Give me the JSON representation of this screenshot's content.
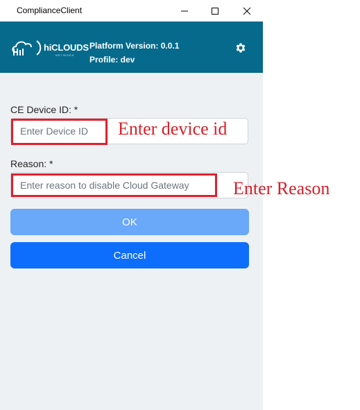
{
  "window": {
    "title": "ComplianceClient",
    "controls": {
      "minimize_icon": "minimize-icon",
      "maximize_icon": "maximize-icon",
      "close_icon": "close-icon"
    }
  },
  "header": {
    "logo_text": "hiCLOUDS",
    "logo_sub": "NETWORK",
    "platform_version": "Platform Version: 0.0.1",
    "profile": "Profile: dev",
    "settings_icon": "gear-icon",
    "background_color": "#066a8c"
  },
  "form": {
    "device_id": {
      "label": "CE Device ID: *",
      "placeholder": "Enter Device ID",
      "value": ""
    },
    "reason": {
      "label": "Reason: *",
      "placeholder": "Enter reason to disable Cloud Gateway",
      "value": ""
    },
    "ok_label": "OK",
    "cancel_label": "Cancel"
  },
  "annotations": {
    "device_note": "Enter device id",
    "reason_note": "Enter Reason",
    "color": "#d8202a"
  },
  "colors": {
    "ok_button": "#6aa8f9",
    "cancel_button": "#0d6efd",
    "window_background": "#eef1f4"
  }
}
